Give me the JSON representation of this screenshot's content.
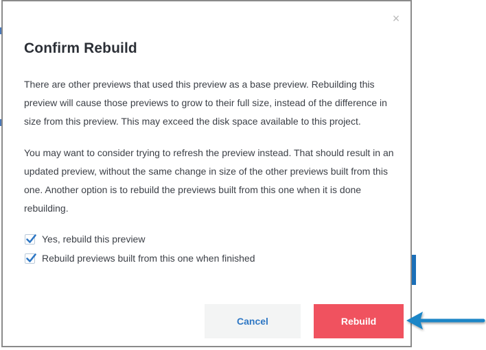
{
  "dialog": {
    "close_glyph": "×",
    "title": "Confirm Rebuild",
    "paragraph_1": "There are other previews that used this preview as a base preview. Rebuilding this preview will cause those previews to grow to their full size, instead of the difference in size from this preview. This may exceed the disk space available to this project.",
    "paragraph_2": "You may want to consider trying to refresh the preview instead. That should result in an updated preview, without the same change in size of the other previews built from this one. Another option is to rebuild the previews built from this one when it is done rebuilding.",
    "options": [
      {
        "label": "Yes, rebuild this preview",
        "checked": true
      },
      {
        "label": "Rebuild previews built from this one when finished",
        "checked": true
      }
    ],
    "cancel_label": "Cancel",
    "rebuild_label": "Rebuild"
  },
  "icons": {
    "close": "close-icon",
    "check": "checkmark-icon",
    "annotation": "arrow-left-icon"
  },
  "colors": {
    "rebuild_button": "#f0525f",
    "cancel_text": "#2e77c4",
    "checkmark": "#2e77c4",
    "annotation_arrow": "#1a86c7"
  }
}
